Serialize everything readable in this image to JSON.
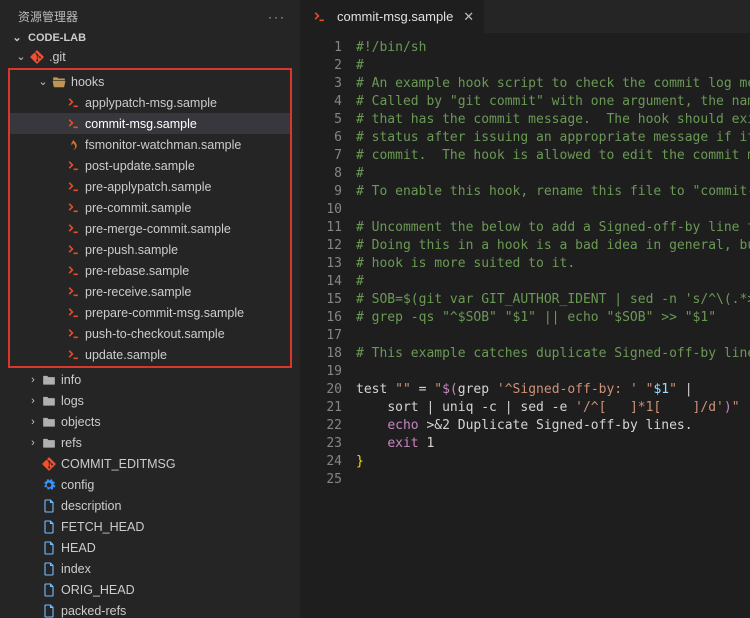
{
  "sidebar": {
    "title": "资源管理器",
    "section": "CODE-LAB",
    "git_folder": ".git",
    "hooks_folder": "hooks",
    "hooks": [
      "applypatch-msg.sample",
      "commit-msg.sample",
      "fsmonitor-watchman.sample",
      "post-update.sample",
      "pre-applypatch.sample",
      "pre-commit.sample",
      "pre-merge-commit.sample",
      "pre-push.sample",
      "pre-rebase.sample",
      "pre-receive.sample",
      "prepare-commit-msg.sample",
      "push-to-checkout.sample",
      "update.sample"
    ],
    "folders": [
      "info",
      "logs",
      "objects",
      "refs"
    ],
    "git_files": [
      {
        "name": "COMMIT_EDITMSG",
        "icon": "git"
      },
      {
        "name": "config",
        "icon": "cog"
      },
      {
        "name": "description",
        "icon": "file"
      },
      {
        "name": "FETCH_HEAD",
        "icon": "file"
      },
      {
        "name": "HEAD",
        "icon": "file"
      },
      {
        "name": "index",
        "icon": "file"
      },
      {
        "name": "ORIG_HEAD",
        "icon": "file"
      },
      {
        "name": "packed-refs",
        "icon": "file"
      }
    ]
  },
  "tab": {
    "label": "commit-msg.sample"
  },
  "code": [
    {
      "t": "#!/bin/sh",
      "c": "comment"
    },
    {
      "t": "#",
      "c": "comment"
    },
    {
      "t": "# An example hook script to check the commit log message.",
      "c": "comment"
    },
    {
      "t": "# Called by \"git commit\" with one argument, the name of t",
      "c": "comment"
    },
    {
      "t": "# that has the commit message.  The hook should exit with",
      "c": "comment"
    },
    {
      "t": "# status after issuing an appropriate message if it wants",
      "c": "comment"
    },
    {
      "t": "# commit.  The hook is allowed to edit the commit message",
      "c": "comment"
    },
    {
      "t": "#",
      "c": "comment"
    },
    {
      "t": "# To enable this hook, rename this file to \"commit-msg\".",
      "c": "comment"
    },
    {
      "t": "",
      "c": "plain"
    },
    {
      "t": "# Uncomment the below to add a Signed-off-by line to the ",
      "c": "comment"
    },
    {
      "t": "# Doing this in a hook is a bad idea in general, but the ",
      "c": "comment"
    },
    {
      "t": "# hook is more suited to it.",
      "c": "comment"
    },
    {
      "t": "#",
      "c": "comment"
    },
    {
      "t": "# SOB=$(git var GIT_AUTHOR_IDENT | sed -n 's/^\\(.*>\\).*$/",
      "c": "comment"
    },
    {
      "t": "# grep -qs \"^$SOB\" \"$1\" || echo \"$SOB\" >> \"$1\"",
      "c": "comment"
    },
    {
      "t": "",
      "c": "plain"
    },
    {
      "t": "# This example catches duplicate Signed-off-by lines.",
      "c": "comment"
    },
    {
      "t": "",
      "c": "plain"
    }
  ],
  "chart_data": null
}
